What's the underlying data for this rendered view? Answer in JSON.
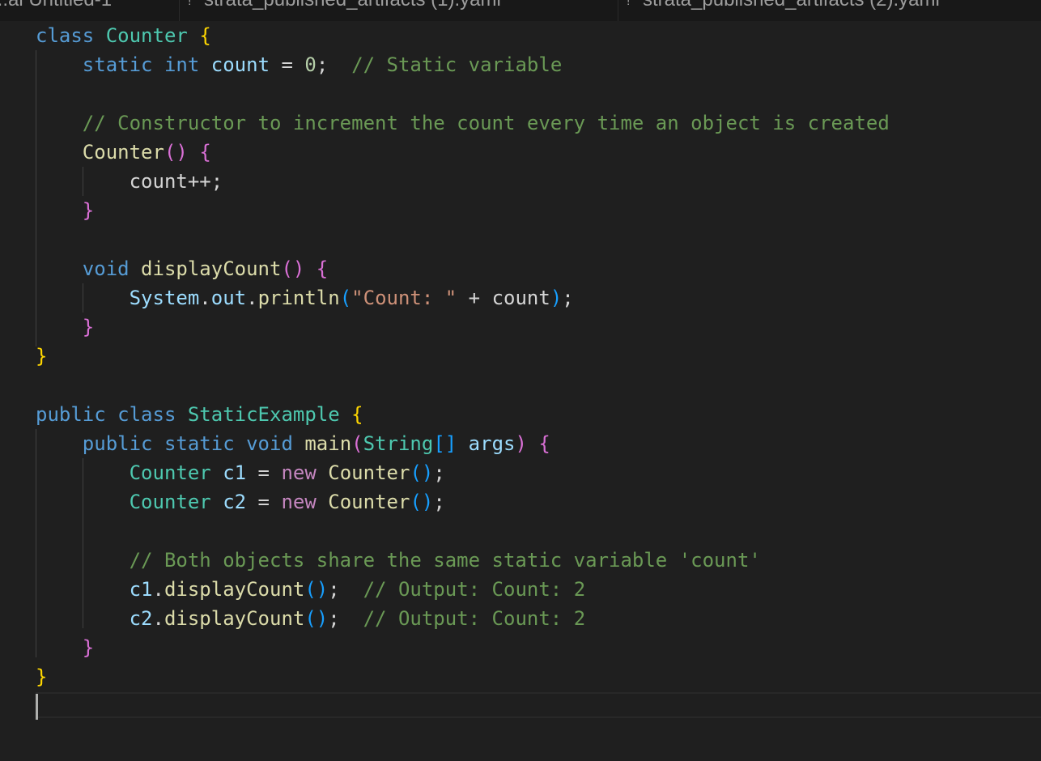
{
  "tabs": [
    {
      "label": "...ai Untitled-1",
      "icon": "file-icon"
    },
    {
      "label": "strata_published_artifacts (1).yaml",
      "icon": "yaml-file-icon"
    },
    {
      "label": "strata_published_artifacts (2).yaml",
      "icon": "yaml-file-icon"
    }
  ],
  "code_lines": [
    [
      [
        "keyword",
        "class"
      ],
      [
        "plain",
        " "
      ],
      [
        "type",
        "Counter"
      ],
      [
        "plain",
        " "
      ],
      [
        "bracket1",
        "{"
      ]
    ],
    [
      [
        "plain",
        "    "
      ],
      [
        "keyword",
        "static"
      ],
      [
        "plain",
        " "
      ],
      [
        "keyword",
        "int"
      ],
      [
        "plain",
        " "
      ],
      [
        "variable",
        "count"
      ],
      [
        "plain",
        " = "
      ],
      [
        "number",
        "0"
      ],
      [
        "plain",
        ";  "
      ],
      [
        "comment",
        "// Static variable"
      ]
    ],
    [],
    [
      [
        "plain",
        "    "
      ],
      [
        "comment",
        "// Constructor to increment the count every time an object is created"
      ]
    ],
    [
      [
        "plain",
        "    "
      ],
      [
        "function",
        "Counter"
      ],
      [
        "bracket2",
        "()"
      ],
      [
        "plain",
        " "
      ],
      [
        "bracket2",
        "{"
      ]
    ],
    [
      [
        "plain",
        "        "
      ],
      [
        "plain",
        "count++;"
      ]
    ],
    [
      [
        "plain",
        "    "
      ],
      [
        "bracket2",
        "}"
      ]
    ],
    [],
    [
      [
        "plain",
        "    "
      ],
      [
        "keyword",
        "void"
      ],
      [
        "plain",
        " "
      ],
      [
        "function",
        "displayCount"
      ],
      [
        "bracket2",
        "()"
      ],
      [
        "plain",
        " "
      ],
      [
        "bracket2",
        "{"
      ]
    ],
    [
      [
        "plain",
        "        "
      ],
      [
        "variable",
        "System"
      ],
      [
        "plain",
        "."
      ],
      [
        "variable",
        "out"
      ],
      [
        "plain",
        "."
      ],
      [
        "function",
        "println"
      ],
      [
        "bracket3",
        "("
      ],
      [
        "string",
        "\"Count: \""
      ],
      [
        "plain",
        " + "
      ],
      [
        "plain",
        "count"
      ],
      [
        "bracket3",
        ")"
      ],
      [
        "plain",
        ";"
      ]
    ],
    [
      [
        "plain",
        "    "
      ],
      [
        "bracket2",
        "}"
      ]
    ],
    [
      [
        "bracket1",
        "}"
      ]
    ],
    [],
    [
      [
        "keyword",
        "public"
      ],
      [
        "plain",
        " "
      ],
      [
        "keyword",
        "class"
      ],
      [
        "plain",
        " "
      ],
      [
        "type",
        "StaticExample"
      ],
      [
        "plain",
        " "
      ],
      [
        "bracket1",
        "{"
      ]
    ],
    [
      [
        "plain",
        "    "
      ],
      [
        "keyword",
        "public"
      ],
      [
        "plain",
        " "
      ],
      [
        "keyword",
        "static"
      ],
      [
        "plain",
        " "
      ],
      [
        "keyword",
        "void"
      ],
      [
        "plain",
        " "
      ],
      [
        "function",
        "main"
      ],
      [
        "bracket2",
        "("
      ],
      [
        "type",
        "String"
      ],
      [
        "bracket3",
        "[]"
      ],
      [
        "plain",
        " "
      ],
      [
        "variable",
        "args"
      ],
      [
        "bracket2",
        ")"
      ],
      [
        "plain",
        " "
      ],
      [
        "bracket2",
        "{"
      ]
    ],
    [
      [
        "plain",
        "        "
      ],
      [
        "type",
        "Counter"
      ],
      [
        "plain",
        " "
      ],
      [
        "variable",
        "c1"
      ],
      [
        "plain",
        " = "
      ],
      [
        "control",
        "new"
      ],
      [
        "plain",
        " "
      ],
      [
        "function",
        "Counter"
      ],
      [
        "bracket3",
        "()"
      ],
      [
        "plain",
        ";"
      ]
    ],
    [
      [
        "plain",
        "        "
      ],
      [
        "type",
        "Counter"
      ],
      [
        "plain",
        " "
      ],
      [
        "variable",
        "c2"
      ],
      [
        "plain",
        " = "
      ],
      [
        "control",
        "new"
      ],
      [
        "plain",
        " "
      ],
      [
        "function",
        "Counter"
      ],
      [
        "bracket3",
        "()"
      ],
      [
        "plain",
        ";"
      ]
    ],
    [],
    [
      [
        "plain",
        "        "
      ],
      [
        "comment",
        "// Both objects share the same static variable 'count'"
      ]
    ],
    [
      [
        "plain",
        "        "
      ],
      [
        "variable",
        "c1"
      ],
      [
        "plain",
        "."
      ],
      [
        "function",
        "displayCount"
      ],
      [
        "bracket3",
        "()"
      ],
      [
        "plain",
        ";  "
      ],
      [
        "comment",
        "// Output: Count: 2"
      ]
    ],
    [
      [
        "plain",
        "        "
      ],
      [
        "variable",
        "c2"
      ],
      [
        "plain",
        "."
      ],
      [
        "function",
        "displayCount"
      ],
      [
        "bracket3",
        "()"
      ],
      [
        "plain",
        ";  "
      ],
      [
        "comment",
        "// Output: Count: 2"
      ]
    ],
    [
      [
        "plain",
        "    "
      ],
      [
        "bracket2",
        "}"
      ]
    ],
    [
      [
        "bracket1",
        "}"
      ]
    ]
  ]
}
